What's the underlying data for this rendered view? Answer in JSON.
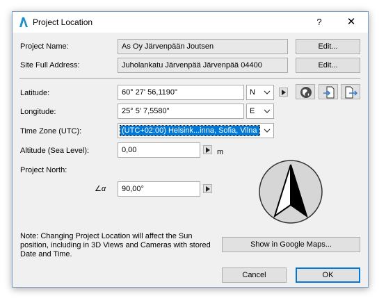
{
  "window": {
    "title": "Project Location",
    "help_glyph": "?",
    "close_glyph": "✕"
  },
  "project_name": {
    "label": "Project Name:",
    "value": "As Oy Järvenpään Joutsen",
    "edit": "Edit..."
  },
  "site_address": {
    "label": "Site Full Address:",
    "value": "Juholankatu Järvenpää Järvenpää 04400",
    "edit": "Edit..."
  },
  "latitude": {
    "label": "Latitude:",
    "value": "60° 27' 56,1190\"",
    "hemisphere": "N"
  },
  "longitude": {
    "label": "Longitude:",
    "value": "25° 5' 7,5580\"",
    "hemisphere": "E"
  },
  "timezone": {
    "label": "Time Zone (UTC):",
    "value": "(UTC+02:00) Helsink...inna, Sofia, Vilna"
  },
  "altitude": {
    "label": "Altitude (Sea Level):",
    "value": "0,00",
    "unit": "m"
  },
  "project_north": {
    "label": "Project North:",
    "value": "90,00°",
    "symbol": "∠α"
  },
  "icons": {
    "globe": "globe-icon",
    "import": "import-icon",
    "export": "export-icon",
    "compass": "compass-icon"
  },
  "note": "Note: Changing Project Location will affect the Sun position, including in 3D Views and Cameras with stored Date and Time.",
  "buttons": {
    "google_maps": "Show in Google Maps...",
    "cancel": "Cancel",
    "ok": "OK"
  },
  "colors": {
    "accent": "#0078d7",
    "dialog_bg": "#f0f0f0"
  }
}
